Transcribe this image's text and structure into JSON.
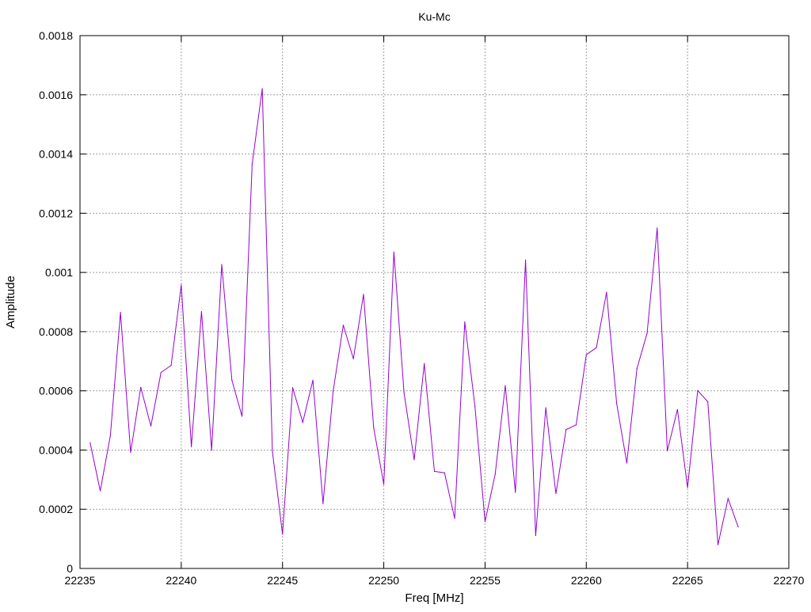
{
  "chart_data": {
    "type": "line",
    "title": "Ku-Mc",
    "xlabel": "Freq [MHz]",
    "ylabel": "Amplitude",
    "xlim": [
      22235,
      22270
    ],
    "ylim": [
      0,
      0.0018
    ],
    "grid": true,
    "x_ticks": [
      22235,
      22240,
      22245,
      22250,
      22255,
      22260,
      22265,
      22270
    ],
    "x_tick_labels": [
      "22235",
      "22240",
      "22245",
      "22250",
      "22255",
      "22260",
      "22265",
      "22270"
    ],
    "y_ticks": [
      0,
      0.0002,
      0.0004,
      0.0006,
      0.0008,
      0.001,
      0.0012,
      0.0014,
      0.0016,
      0.0018
    ],
    "y_tick_labels": [
      "0",
      "0.0002",
      "0.0004",
      "0.0006",
      "0.0008",
      "0.001",
      "0.0012",
      "0.0014",
      "0.0016",
      "0.0018"
    ],
    "series": [
      {
        "color": "#9400d3",
        "x": [
          22235.5,
          22236,
          22236.5,
          22237,
          22237.5,
          22238,
          22238.5,
          22239,
          22239.5,
          22240,
          22240.5,
          22241,
          22241.5,
          22242,
          22242.5,
          22243,
          22243.5,
          22244,
          22244.5,
          22245,
          22245.5,
          22246,
          22246.5,
          22247,
          22247.5,
          22248,
          22248.5,
          22249,
          22249.5,
          22250,
          22250.5,
          22251,
          22251.5,
          22252,
          22252.5,
          22253,
          22253.5,
          22254,
          22254.5,
          22255,
          22255.5,
          22256,
          22256.5,
          22257,
          22257.5,
          22258,
          22258.5,
          22259,
          22259.5,
          22260,
          22260.5,
          22261,
          22261.5,
          22262,
          22262.5,
          22263,
          22263.5,
          22264,
          22264.5,
          22265,
          22265.5,
          22266,
          22266.5,
          22267,
          22267.5
        ],
        "values": [
          0.000425,
          0.000262,
          0.000449,
          0.000865,
          0.000392,
          0.000612,
          0.000481,
          0.000662,
          0.000686,
          0.000958,
          0.000411,
          0.000868,
          0.000399,
          0.001027,
          0.000636,
          0.000514,
          0.001366,
          0.001621,
          0.000396,
          0.000116,
          0.000611,
          0.000494,
          0.000636,
          0.000219,
          0.000599,
          0.000822,
          0.000708,
          0.000926,
          0.000476,
          0.000284,
          0.001069,
          0.000593,
          0.000367,
          0.000692,
          0.000328,
          0.000323,
          0.000169,
          0.000833,
          0.000548,
          0.000158,
          0.000318,
          0.000618,
          0.000257,
          0.001042,
          0.000111,
          0.000543,
          0.000253,
          0.000469,
          0.000485,
          0.000722,
          0.000746,
          0.000933,
          0.000557,
          0.000356,
          0.000675,
          0.000794,
          0.00115,
          0.000397,
          0.000537,
          0.000273,
          0.000601,
          0.000563,
          8e-05,
          0.000236,
          0.00014
        ]
      }
    ]
  }
}
